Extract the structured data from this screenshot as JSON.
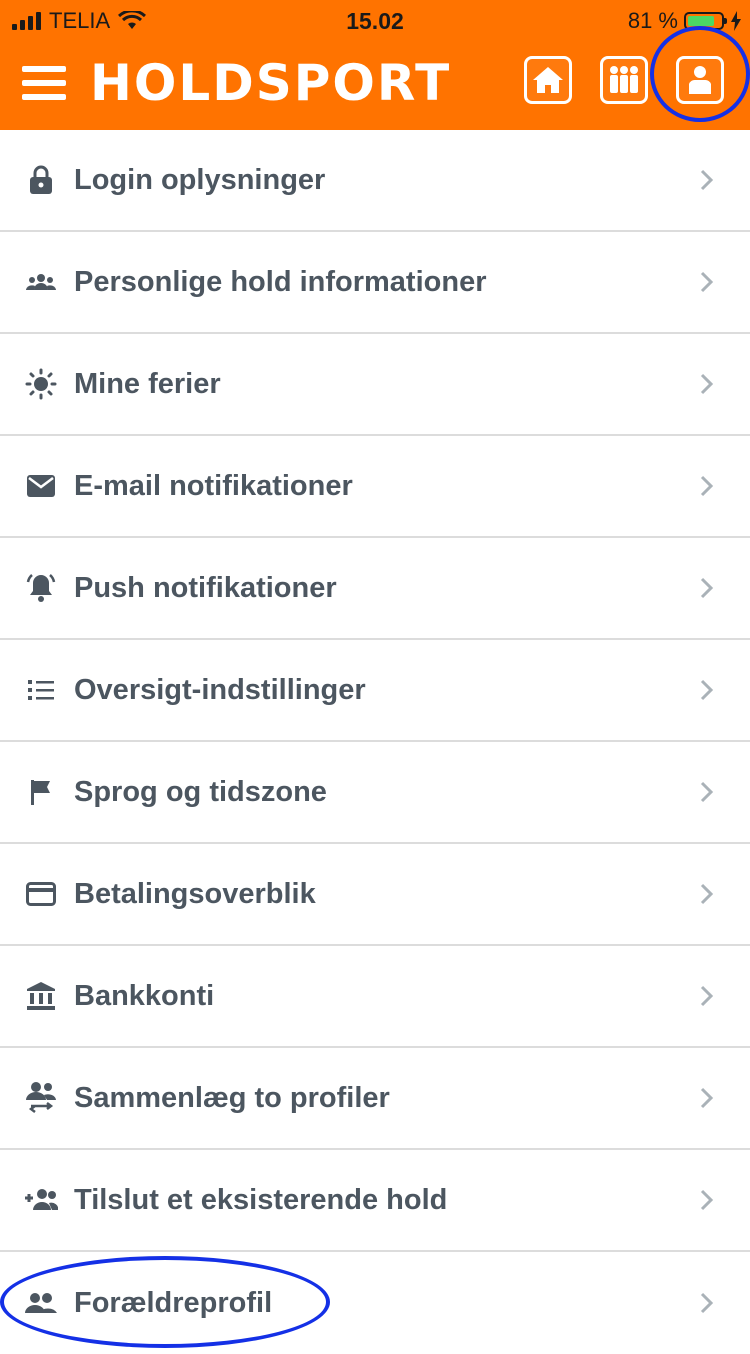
{
  "status_bar": {
    "carrier": "TELIA",
    "time": "15.02",
    "battery": "81 %",
    "battery_level": 0.81
  },
  "header": {
    "brand": "HOLDSPORT",
    "colors": {
      "accent": "#ff7300",
      "highlight": "#1430e6"
    },
    "icons": [
      "menu-icon",
      "home-icon",
      "team-icon",
      "profile-icon"
    ]
  },
  "menu": {
    "items": [
      {
        "label": "Login oplysninger",
        "icon": "lock-icon"
      },
      {
        "label": "Personlige hold informationer",
        "icon": "group-icon"
      },
      {
        "label": "Mine ferier",
        "icon": "sun-icon"
      },
      {
        "label": "E-mail notifikationer",
        "icon": "mail-icon"
      },
      {
        "label": "Push notifikationer",
        "icon": "bell-icon"
      },
      {
        "label": "Oversigt-indstillinger",
        "icon": "list-icon"
      },
      {
        "label": "Sprog og tidszone",
        "icon": "flag-icon"
      },
      {
        "label": "Betalingsoverblik",
        "icon": "credit-card-icon"
      },
      {
        "label": "Bankkonti",
        "icon": "bank-icon"
      },
      {
        "label": "Sammenlæg to profiler",
        "icon": "merge-people-icon"
      },
      {
        "label": "Tilslut et eksisterende hold",
        "icon": "add-people-icon"
      },
      {
        "label": "Forældreprofil",
        "icon": "parent-people-icon"
      }
    ]
  }
}
